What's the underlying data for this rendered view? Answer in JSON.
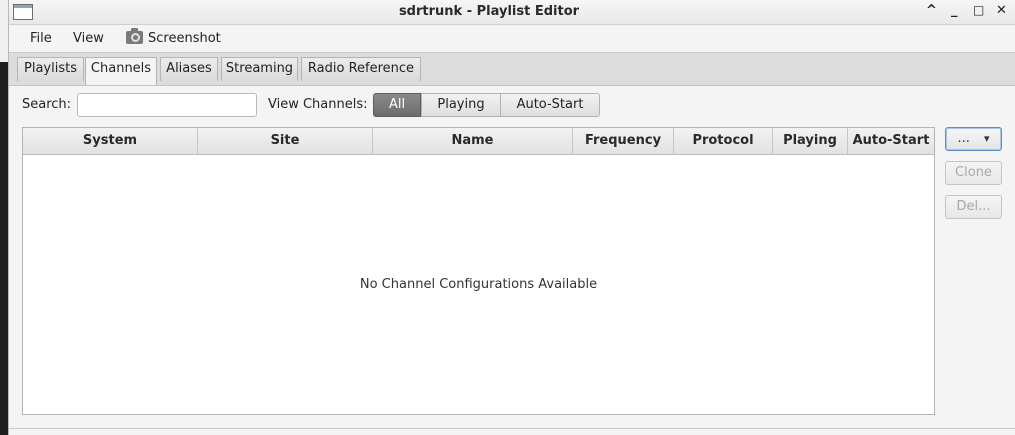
{
  "window": {
    "title": "sdrtrunk - Playlist Editor",
    "controls": {
      "minimize_glyph": "^",
      "iconify_glyph": "_",
      "maximize_glyph": "□",
      "close_glyph": "✕"
    }
  },
  "menubar": {
    "file": "File",
    "view": "View",
    "screenshot": "Screenshot",
    "screenshot_icon": "camera-icon"
  },
  "tabs": [
    {
      "label": "Playlists",
      "active": false
    },
    {
      "label": "Channels",
      "active": true
    },
    {
      "label": "Aliases",
      "active": false
    },
    {
      "label": "Streaming",
      "active": false
    },
    {
      "label": "Radio Reference",
      "active": false
    }
  ],
  "filter": {
    "search_label": "Search:",
    "search_value": "",
    "view_channels_label": "View Channels:",
    "options": [
      "All",
      "Playing",
      "Auto-Start"
    ],
    "selected": "All"
  },
  "table": {
    "columns": [
      "System",
      "Site",
      "Name",
      "Frequency",
      "Protocol",
      "Playing",
      "Auto-Start"
    ],
    "rows": [],
    "empty_message": "No Channel Configurations Available"
  },
  "side_buttons": {
    "menu_label": "...",
    "menu_arrow": "▾",
    "clone_label": "Clone",
    "delete_label": "Del..."
  },
  "colors": {
    "selected_segment": "#7a7a7a",
    "focus_border": "#5f8fc9",
    "disabled_text": "#a8a8a8"
  }
}
